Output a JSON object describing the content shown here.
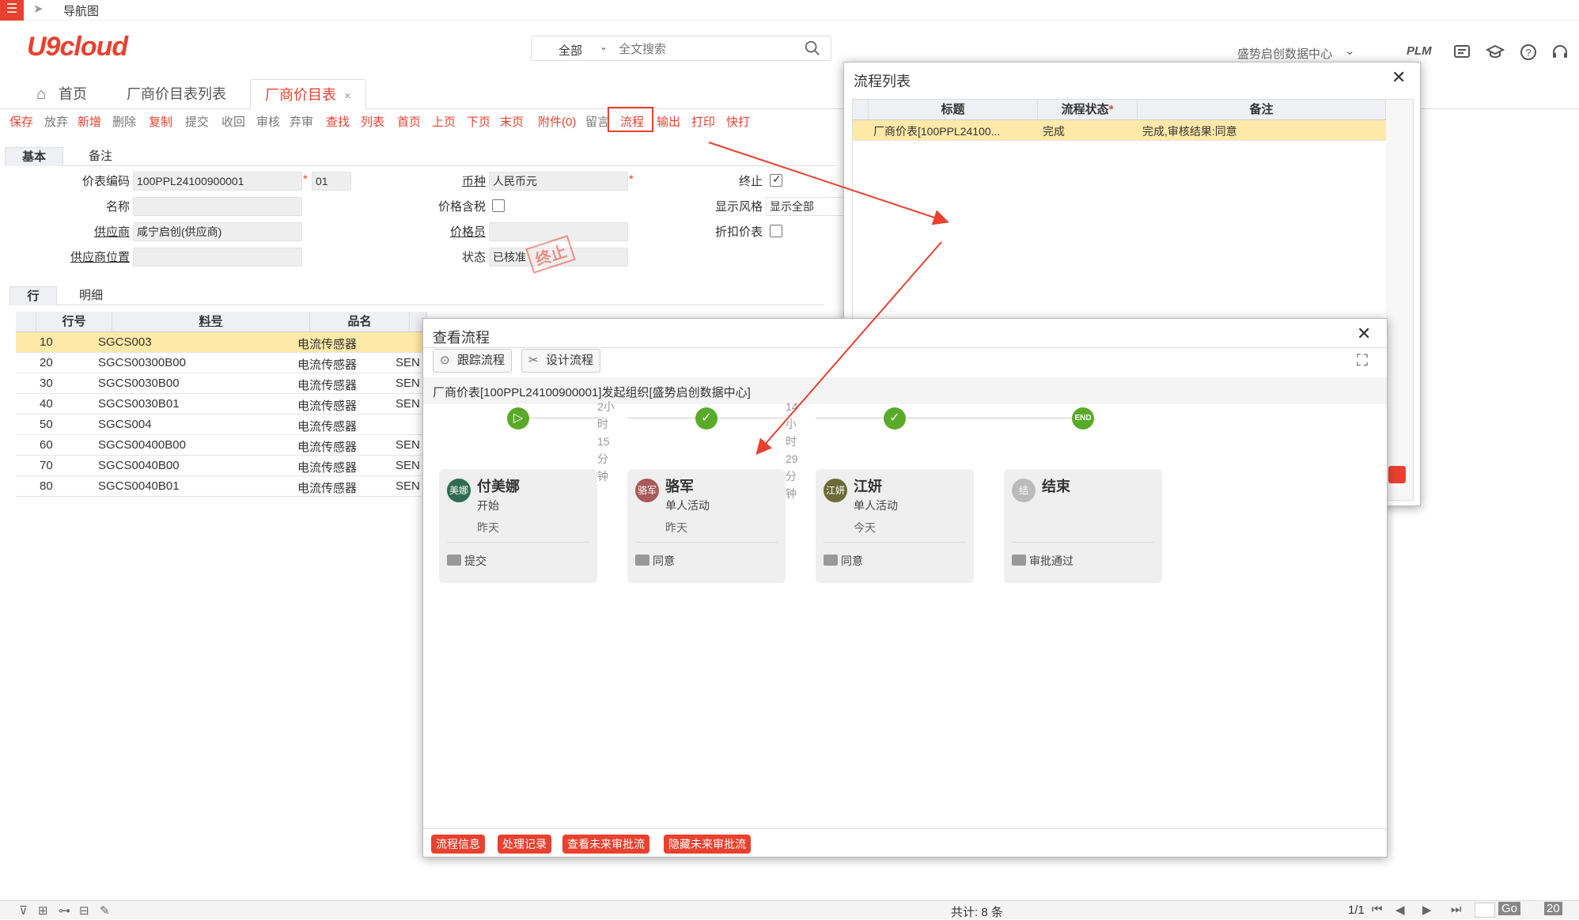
{
  "topbar": {
    "menu_icon": "menu-icon",
    "nav_label": "导航图"
  },
  "header": {
    "logo": "U9cloud",
    "search_scope": "全部",
    "search_placeholder": "全文搜索",
    "org_name": "盛势启创数据中心",
    "plm_label": "PLM"
  },
  "tabs": [
    {
      "label": "首页"
    },
    {
      "label": "厂商价目表列表"
    },
    {
      "label": "厂商价目表",
      "active": true
    }
  ],
  "toolbar": {
    "items": [
      "保存",
      "放弃",
      "新增",
      "删除",
      "复制",
      "提交",
      "收回",
      "审核",
      "弃审",
      "查找",
      "列表",
      "首页",
      "上页",
      "下页",
      "末页",
      "附件(0)",
      "留言",
      "流程",
      "输出",
      "打印",
      "快打"
    ]
  },
  "form_tabs": [
    "基本",
    "备注"
  ],
  "form": {
    "price_code_label": "价表编码",
    "price_code": "100PPL24100900001",
    "version": "01",
    "currency_label": "币种",
    "currency": "人民币元",
    "terminated_label": "终止",
    "name_label": "名称",
    "tax_included_label": "价格含税",
    "display_style_label": "显示风格",
    "display_style": "显示全部",
    "supplier_label": "供应商",
    "supplier": "咸宁启创(供应商)",
    "pricer_label": "价格员",
    "discount_label": "折扣价表",
    "supplier_location_label": "供应商位置",
    "status_label": "状态",
    "status": "已核准",
    "stamp": "终止"
  },
  "grid_tabs": [
    "行",
    "明细"
  ],
  "grid": {
    "headers": [
      "行号",
      "料号",
      "品名"
    ],
    "rows": [
      {
        "no": "10",
        "code": "SGCS003",
        "name": "电流传感器",
        "extra": ""
      },
      {
        "no": "20",
        "code": "SGCS00300B00",
        "name": "电流传感器",
        "extra": "SEN"
      },
      {
        "no": "30",
        "code": "SGCS0030B00",
        "name": "电流传感器",
        "extra": "SEN"
      },
      {
        "no": "40",
        "code": "SGCS0030B01",
        "name": "电流传感器",
        "extra": "SEN"
      },
      {
        "no": "50",
        "code": "SGCS004",
        "name": "电流传感器",
        "extra": ""
      },
      {
        "no": "60",
        "code": "SGCS00400B00",
        "name": "电流传感器",
        "extra": "SEN"
      },
      {
        "no": "70",
        "code": "SGCS0040B00",
        "name": "电流传感器",
        "extra": "SEN"
      },
      {
        "no": "80",
        "code": "SGCS0040B01",
        "name": "电流传感器",
        "extra": "SEN"
      }
    ]
  },
  "statusbar": {
    "total": "共计: 8 条",
    "page": "1/1",
    "go": "Go",
    "page_size": "20"
  },
  "process_list": {
    "title": "流程列表",
    "headers": [
      "标题",
      "流程状态",
      "备注"
    ],
    "row": {
      "title": "厂商价表[100PPL24100...",
      "status": "完成",
      "note": "完成,审核结果:同意"
    }
  },
  "view_flow": {
    "title": "查看流程",
    "btn_track": "跟踪流程",
    "btn_design": "设计流程",
    "subtitle": "厂商价表[100PPL24100900001]发起组织[盛势启创数据中心]",
    "durations": [
      "2小时15分钟",
      "14小时29分钟"
    ],
    "end_label": "END",
    "cards": [
      {
        "avatar": "美娜",
        "avatar_color": "#2e6b4f",
        "name": "付美娜",
        "activity": "开始",
        "time": "昨天",
        "comment": "提交"
      },
      {
        "avatar": "骆军",
        "avatar_color": "#a85a5a",
        "name": "骆军",
        "activity": "单人活动",
        "time": "昨天",
        "comment": "同意"
      },
      {
        "avatar": "江妍",
        "avatar_color": "#6b6b3a",
        "name": "江妍",
        "activity": "单人活动",
        "time": "今天",
        "comment": "同意"
      },
      {
        "avatar": "结",
        "avatar_color": "#bbbbbb",
        "name": "结束",
        "activity": "",
        "time": "",
        "comment": "审批通过"
      }
    ],
    "footer_buttons": [
      "流程信息",
      "处理记录",
      "查看未来审批流",
      "隐藏未来审批流"
    ]
  },
  "colors": {
    "accent": "#e8412f",
    "selected_row": "#ffe9a8",
    "node_green": "#5aaa2a"
  }
}
